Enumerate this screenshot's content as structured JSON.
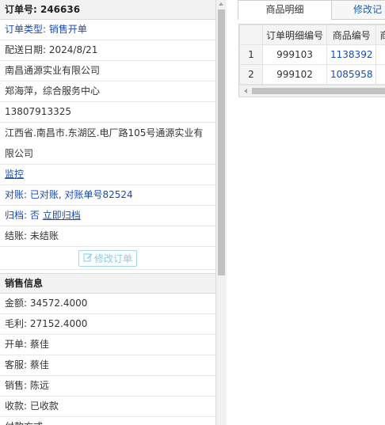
{
  "order": {
    "header": "订单号: 246636",
    "type": "订单类型: 销售开单",
    "delivery_date": "配送日期: 2024/8/21",
    "company": "南昌通源实业有限公司",
    "contact": "郑海萍，综合服务中心",
    "phone": "13807913325",
    "address": "江西省.南昌市.东湖区.电厂路105号通源实业有限公司",
    "monitor": "监控",
    "reconcile": "对账: 已对账, 对账单号82524",
    "archive_label": "归档: ",
    "archive_status": "否",
    "archive_link": "立即归档",
    "settle": "结账: 未结账",
    "edit_button": "修改订单"
  },
  "sales": {
    "header": "销售信息",
    "amount": "金额: 34572.4000",
    "profit": "毛利: 27152.4000",
    "invoice_by": "开单: 蔡佳",
    "service_by": "客服: 蔡佳",
    "sales_by": "销售: 陈远",
    "payment_status": "收款: 已收款",
    "payment_method": "付款方式"
  },
  "tabs": [
    {
      "label": "商品明细"
    },
    {
      "label": "修改记"
    }
  ],
  "table": {
    "columns": [
      "",
      "订单明细编号",
      "商品编号",
      "商"
    ],
    "rows": [
      {
        "index": "1",
        "detail_id": "999103",
        "product_id": "1138392"
      },
      {
        "index": "2",
        "detail_id": "999102",
        "product_id": "1085958"
      }
    ]
  },
  "colors": {
    "link": "#1a4bb3",
    "header_bg": "#f2f2f2",
    "button_border": "#a9d7ea"
  }
}
